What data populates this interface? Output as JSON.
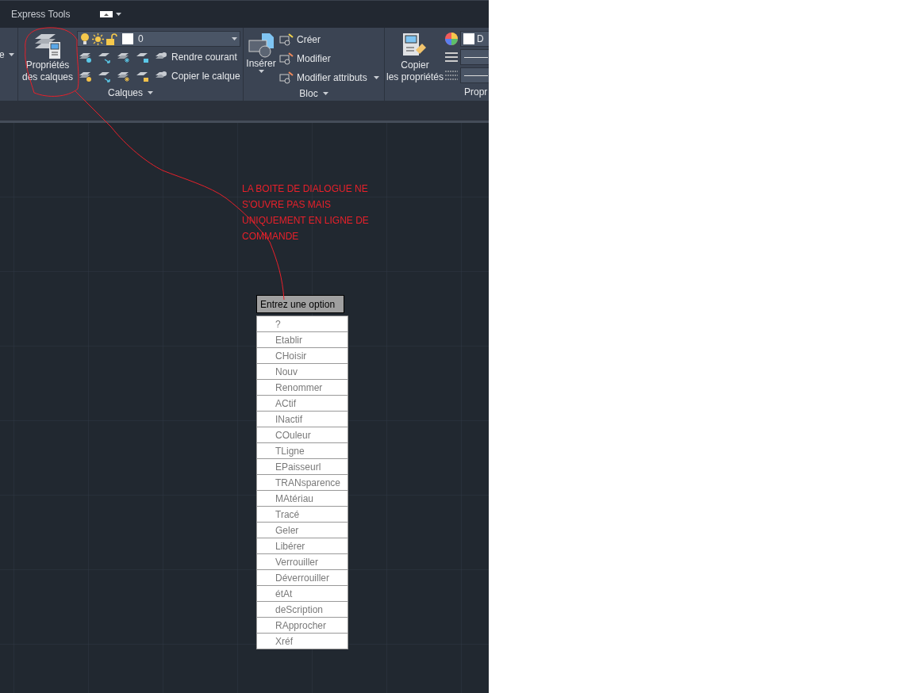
{
  "ribbon_tabs": [
    {
      "label": "Express Tools"
    }
  ],
  "ribbon": {
    "left_fragment": {
      "label": "e"
    },
    "layers_panel": {
      "title": "Calques",
      "big_button": {
        "label_lines": [
          "Propriétés",
          "des calques"
        ]
      },
      "layer_combo": {
        "value": "0"
      },
      "buttons": [
        "Rendre courant",
        "Copier le calque"
      ]
    },
    "block_panel": {
      "title": "Bloc",
      "insert_button": "Insérer",
      "buttons": [
        "Créer",
        "Modifier",
        "Modifier attributs"
      ]
    },
    "properties_panel": {
      "title": "Propr",
      "big_button": {
        "label_lines": [
          "Copier",
          "les propriétés"
        ]
      },
      "color_combo": {
        "value": "D"
      }
    }
  },
  "annotation": {
    "text": "LA BOITE DE DIALOGUE NE S'OUVRE PAS MAIS UNIQUEMENT EN LIGNE DE COMMANDE"
  },
  "command_prompt": {
    "title": "Entrez une option",
    "options": [
      "?",
      "Etablir",
      "CHoisir",
      "Nouv",
      "Renommer",
      "ACtif",
      "INactif",
      "COuleur",
      "TLigne",
      "EPaisseurl",
      "TRANsparence",
      "MAtériau",
      "Tracé",
      "Geler",
      "Libérer",
      "Verrouiller",
      "Déverrouiller",
      "étAt",
      "deScription",
      "RApprocher",
      "Xréf"
    ]
  }
}
